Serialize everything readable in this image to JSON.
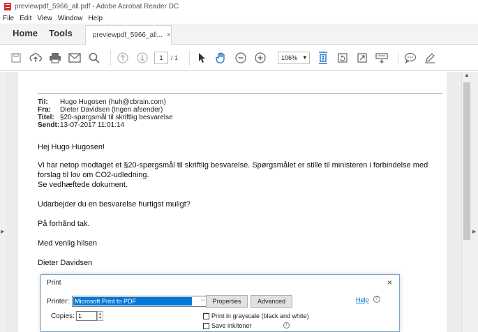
{
  "window": {
    "title": "previewpdf_5966_all.pdf - Adobe Acrobat Reader DC"
  },
  "menu": [
    "File",
    "Edit",
    "View",
    "Window",
    "Help"
  ],
  "tabs": {
    "home": "Home",
    "tools": "Tools",
    "doc": "previewpdf_5966_all...",
    "doc_close": "×"
  },
  "toolbar": {
    "page_current": "1",
    "page_total": "/ 1",
    "zoom": "106%",
    "zoom_caret": "▾"
  },
  "email": {
    "to_label": "Til:",
    "to_value": "Hugo Hugosen (huh@cbrain.com)",
    "from_label": "Fra:",
    "from_value": "Dieter Davidsen (Ingen afsender)",
    "subject_label": "Titel:",
    "subject_value": "§20-spørgsmål til skriftlig besvarelse",
    "sent_label": "Sendt:",
    "sent_value": "13-07-2017 11:01:14",
    "greeting": "Hej Hugo Hugosen!",
    "para1_line1": "Vi har netop modtaget et §20-spørgsmål til skriftlig besvarelse. Spørgsmålet er stille til ministeren i forbindelse med",
    "para1_line2": "forslag til lov om CO2-udledning.",
    "para1_line3": "Se vedhæftede dokument.",
    "para2": "Udarbejder du en besvarelse hurtigst muligt?",
    "para3": "På forhånd tak.",
    "closing": "Med venlig hilsen",
    "signature": "Dieter Davidsen"
  },
  "print_dialog": {
    "title": "Print",
    "close": "×",
    "printer_label": "Printer:",
    "printer_value": "Microsoft Print to PDF",
    "properties": "Properties",
    "advanced": "Advanced",
    "help": "Help",
    "copies_label": "Copies:",
    "copies_value": "1",
    "grayscale_label": "Print in grayscale (black and white)",
    "ink_label": "Save ink/toner"
  }
}
